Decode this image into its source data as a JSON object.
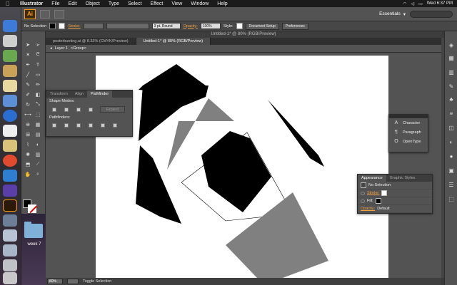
{
  "menubar": {
    "apple": "",
    "items": [
      "Illustrator",
      "File",
      "Edit",
      "Object",
      "Type",
      "Select",
      "Effect",
      "View",
      "Window",
      "Help"
    ],
    "clock": "Wed 6:37 PM"
  },
  "appbar": {
    "logo": "Ai",
    "workspace": "Essentials",
    "workspace_caret": "▾"
  },
  "controlbar": {
    "selection": "No Selection",
    "stroke_label": "Stroke:",
    "stroke_weight": "",
    "brush_def": "3 pt. Round",
    "opacity_label": "Opacity:",
    "opacity_value": "100%",
    "style_label": "Style:",
    "document_setup": "Document Setup",
    "preferences": "Preferences"
  },
  "window": {
    "title": "Untitled-1* @ 80% (RGB/Preview)",
    "tabs": [
      {
        "label": "posterbunting.ai @ 8.33% (CMYK/Preview)",
        "active": false
      },
      {
        "label": "Untitled-1* @ 80% (RGB/Preview)",
        "active": true
      }
    ],
    "breadcrumb": {
      "layer": "Layer 1",
      "group": "<Group>"
    }
  },
  "pathfinder_panel": {
    "tabs": [
      "Transform",
      "Align",
      "Pathfinder"
    ],
    "active_tab": "Pathfinder",
    "shape_modes_label": "Shape Modes:",
    "pathfinders_label": "Pathfinders:",
    "expand_label": "Expand"
  },
  "character_panel": {
    "items": [
      {
        "icon": "A",
        "label": "Character"
      },
      {
        "icon": "¶",
        "label": "Paragraph"
      },
      {
        "icon": "O",
        "label": "OpenType"
      }
    ]
  },
  "appearance_panel": {
    "tabs": [
      "Appearance",
      "Graphic Styles"
    ],
    "selection": "No Selection",
    "stroke_label": "Stroke:",
    "fill_label": "Fill:",
    "opacity_label": "Opacity:",
    "opacity_value": "Default"
  },
  "statusbar": {
    "zoom": "80%",
    "toggle": "Toggle Selection"
  },
  "desktop": {
    "folder_label": "week 7"
  },
  "colors": {
    "accent": "#ff9a00",
    "ui_dark": "#535353",
    "artboard": "#ffffff",
    "shape_black": "#000000",
    "shape_gray": "#7f7f7f"
  }
}
